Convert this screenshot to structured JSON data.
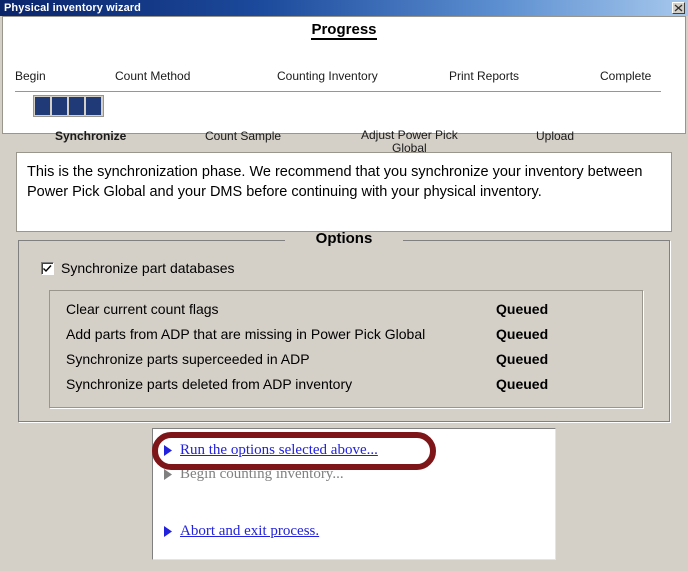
{
  "window": {
    "title": "Physical inventory wizard",
    "close_icon": "close-icon"
  },
  "progress": {
    "title": "Progress",
    "top_steps": [
      {
        "label": "Begin",
        "active": false
      },
      {
        "label": "Count Method",
        "active": false
      },
      {
        "label": "Counting Inventory",
        "active": false
      },
      {
        "label": "Print Reports",
        "active": false
      },
      {
        "label": "Complete",
        "active": false
      }
    ],
    "bottom_steps": [
      {
        "label": "Synchronize",
        "active": true
      },
      {
        "label": "Count Sample",
        "active": false
      },
      {
        "label": "Adjust Power Pick",
        "sublabel": "Global",
        "active": false
      },
      {
        "label": "Upload",
        "active": false
      }
    ],
    "blocks_filled": 4,
    "bar_color": "#1f3a76"
  },
  "instructions": {
    "text": "This is the synchronization phase.  We recommend that you synchronize your inventory between Power Pick Global and your DMS before continuing with your physical inventory."
  },
  "options": {
    "legend": "Options",
    "checkbox": {
      "label": "Synchronize part databases",
      "checked": true
    },
    "queue_items": [
      {
        "label": "Clear current count flags",
        "status": "Queued"
      },
      {
        "label": "Add parts from ADP that are missing in Power Pick Global",
        "status": "Queued"
      },
      {
        "label": "Synchronize parts superceeded in ADP",
        "status": "Queued"
      },
      {
        "label": "Synchronize parts deleted from ADP inventory",
        "status": "Queued"
      }
    ]
  },
  "actions": {
    "run_options": {
      "label": "Run the options selected above...",
      "enabled": true
    },
    "begin_counting": {
      "label": "Begin counting inventory...",
      "enabled": false
    },
    "abort": {
      "label": "Abort and exit process.",
      "enabled": true
    }
  },
  "annotation": {
    "color": "#7e1518",
    "target": "run-options-link"
  }
}
